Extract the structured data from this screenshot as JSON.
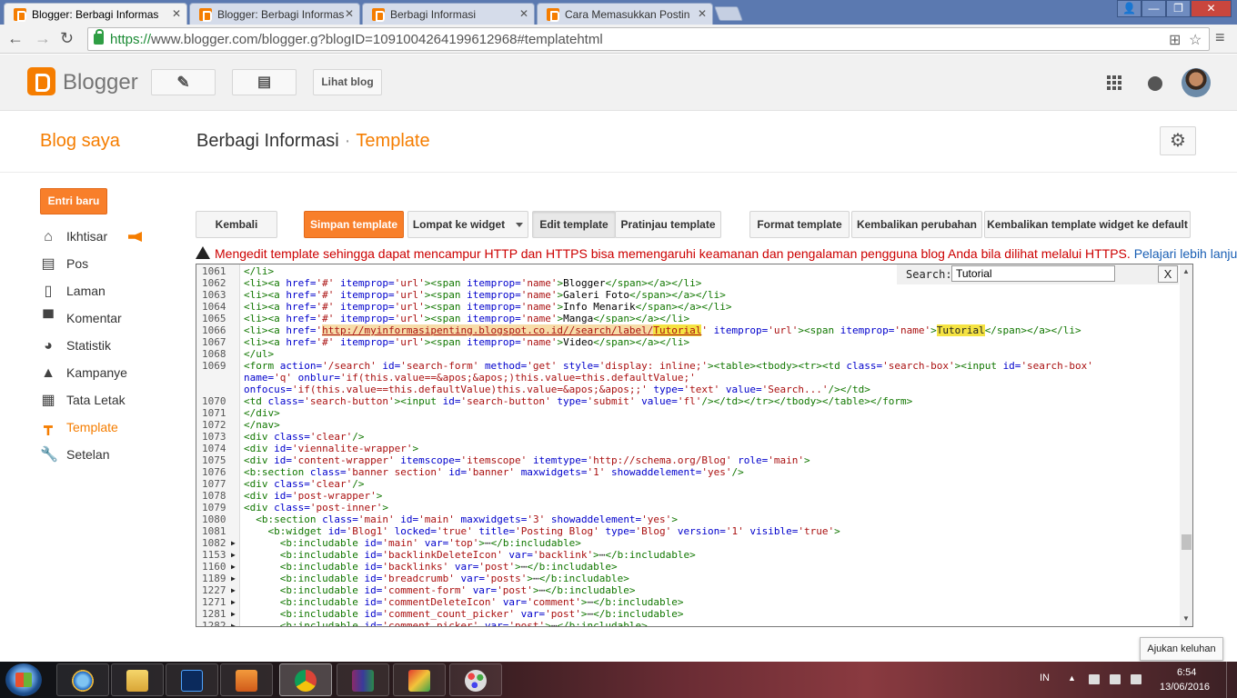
{
  "browser": {
    "tabs": [
      {
        "title": "Blogger: Berbagi Informas",
        "active": true
      },
      {
        "title": "Blogger: Berbagi Informas",
        "active": false
      },
      {
        "title": "Berbagi Informasi",
        "active": false
      },
      {
        "title": "Cara Memasukkan Postin",
        "active": false
      }
    ],
    "url_scheme": "https://",
    "url_rest": "www.blogger.com/blogger.g?blogID=1091004264199612968#templatehtml"
  },
  "header": {
    "app_name": "Blogger",
    "view_blog_label": "Lihat blog"
  },
  "titlebar": {
    "my_blogs": "Blog saya",
    "blog_name": "Berbagi Informasi",
    "separator": "·",
    "section": "Template"
  },
  "sidebar": {
    "new_post": "Entri baru",
    "items": [
      {
        "label": "Ikhtisar",
        "icon": "home-icon"
      },
      {
        "label": "Pos",
        "icon": "posts-icon"
      },
      {
        "label": "Laman",
        "icon": "pages-icon"
      },
      {
        "label": "Komentar",
        "icon": "comment-icon"
      },
      {
        "label": "Statistik",
        "icon": "pie-chart-icon"
      },
      {
        "label": "Kampanye",
        "icon": "campaign-icon"
      },
      {
        "label": "Tata Letak",
        "icon": "layout-icon"
      },
      {
        "label": "Template",
        "icon": "template-icon",
        "active": true
      },
      {
        "label": "Setelan",
        "icon": "wrench-icon"
      }
    ]
  },
  "toolbar": {
    "back": "Kembali",
    "save": "Simpan template",
    "jump_widget": "Lompat ke widget",
    "edit_template": "Edit template",
    "preview_template": "Pratinjau template",
    "format_template": "Format template",
    "revert_changes": "Kembalikan perubahan",
    "revert_widgets": "Kembalikan template widget ke default"
  },
  "warning": {
    "text": "Mengedit template sehingga dapat mencampur HTTP dan HTTPS bisa memengaruhi keamanan dan pengalaman pengguna blog Anda bila dilihat melalui HTTPS.",
    "learn_more": "Pelajari lebih lanjut."
  },
  "editor": {
    "search_label": "Search:",
    "search_value": "Tutorial",
    "close_label": "X"
  },
  "tooltip": "Ajukan keluhan",
  "taskbar": {
    "language": "IN",
    "time": "6:54",
    "date": "13/06/2016"
  },
  "colors": {
    "brand": "#f57d00",
    "save_button": "#f87f2a",
    "warning_text": "#cc0000",
    "link": "#1a5fb4"
  }
}
